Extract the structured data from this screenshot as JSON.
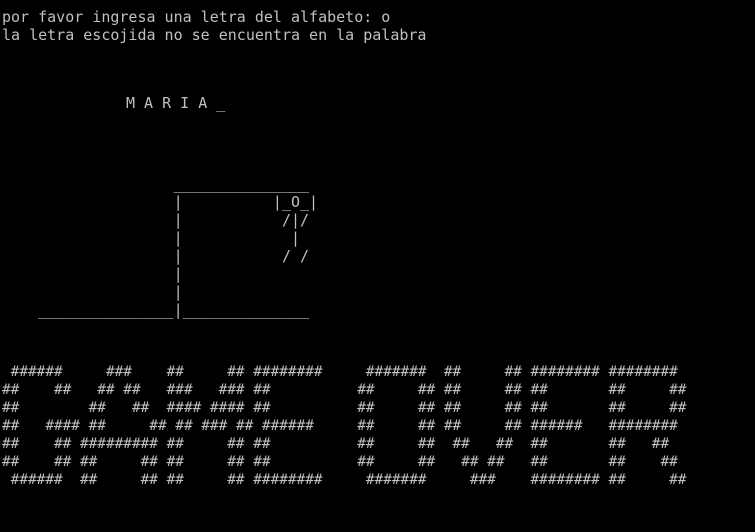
{
  "console": {
    "prompt": "por favor ingresa una letra del alfabeto: o",
    "result": "la letra escojida no se encuentra en la palabra",
    "word_display": "M A R I A _",
    "gallows_art": "                   _______________\n                   |          |_O_|\n                   |           /|/\n                   |            |\n                   |           / /\n                   |\n                   |\n    _______________|______________",
    "game_over_banner": " ######     ###    ##     ## ########     #######  ##     ## ######## ########\n##    ##   ## ##   ###   ### ##          ##     ## ##     ## ##       ##     ##\n##        ##   ##  #### #### ##          ##     ## ##     ## ##       ##     ##\n##   #### ##     ## ## ### ## ######     ##     ## ##     ## ######   ########\n##    ## ######### ##     ## ##          ##     ##  ##   ##  ##       ##   ##\n##    ## ##     ## ##     ## ##          ##     ##   ## ##   ##       ##    ##\n ######  ##     ## ##     ## ########     #######     ###    ######## ##     ##"
  },
  "colors": {
    "background": "#000000",
    "text": "#c0c0c0"
  }
}
